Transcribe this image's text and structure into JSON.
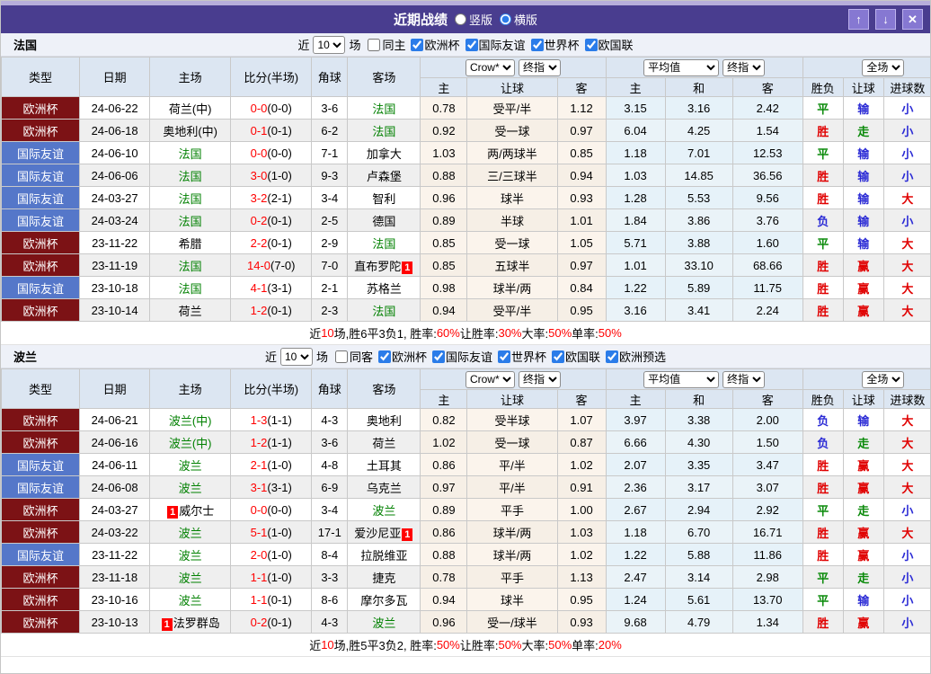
{
  "titlebar": {
    "title": "近期战绩",
    "radio_vertical": "竖版",
    "radio_horizontal": "横版",
    "icons": {
      "up": "↑",
      "down": "↓",
      "close": "✕"
    }
  },
  "headers": {
    "type": "类型",
    "date": "日期",
    "home": "主场",
    "score": "比分(半场)",
    "corner": "角球",
    "away": "客场",
    "home_odds": "主",
    "handicap": "让球",
    "away_odds": "客",
    "avg_home": "主",
    "avg_draw": "和",
    "avg_away": "客",
    "result": "胜负",
    "handicap_result": "让球",
    "goals": "进球数"
  },
  "controls": {
    "crow": "Crow*",
    "final": "终指",
    "average": "平均值",
    "full": "全场"
  },
  "sections": [
    {
      "team": "法国",
      "filter": {
        "near_label": "近",
        "count": "10",
        "unit_label": "场",
        "same_label": "同主",
        "competitions": [
          "欧洲杯",
          "国际友谊",
          "世界杯",
          "欧国联"
        ]
      },
      "rows": [
        {
          "league": "欧洲杯",
          "date": "24-06-22",
          "home": "荷兰(中)",
          "home_focus": false,
          "score": "0-0",
          "half": "(0-0)",
          "corner": "3-6",
          "away": "法国",
          "away_focus": true,
          "odds": [
            "0.78",
            "受平/半",
            "1.12"
          ],
          "avg": [
            "3.15",
            "3.16",
            "2.42"
          ],
          "res": [
            "平",
            "输",
            "小"
          ]
        },
        {
          "league": "欧洲杯",
          "date": "24-06-18",
          "home": "奥地利(中)",
          "home_focus": false,
          "score": "0-1",
          "half": "(0-1)",
          "corner": "6-2",
          "away": "法国",
          "away_focus": true,
          "odds": [
            "0.92",
            "受一球",
            "0.97"
          ],
          "avg": [
            "6.04",
            "4.25",
            "1.54"
          ],
          "res": [
            "胜",
            "走",
            "小"
          ]
        },
        {
          "league": "国际友谊",
          "date": "24-06-10",
          "home": "法国",
          "home_focus": true,
          "score": "0-0",
          "half": "(0-0)",
          "corner": "7-1",
          "away": "加拿大",
          "away_focus": false,
          "odds": [
            "1.03",
            "两/两球半",
            "0.85"
          ],
          "avg": [
            "1.18",
            "7.01",
            "12.53"
          ],
          "res": [
            "平",
            "输",
            "小"
          ]
        },
        {
          "league": "国际友谊",
          "date": "24-06-06",
          "home": "法国",
          "home_focus": true,
          "score": "3-0",
          "half": "(1-0)",
          "corner": "9-3",
          "away": "卢森堡",
          "away_focus": false,
          "odds": [
            "0.88",
            "三/三球半",
            "0.94"
          ],
          "avg": [
            "1.03",
            "14.85",
            "36.56"
          ],
          "res": [
            "胜",
            "输",
            "小"
          ]
        },
        {
          "league": "国际友谊",
          "date": "24-03-27",
          "home": "法国",
          "home_focus": true,
          "score": "3-2",
          "half": "(2-1)",
          "corner": "3-4",
          "away": "智利",
          "away_focus": false,
          "odds": [
            "0.96",
            "球半",
            "0.93"
          ],
          "avg": [
            "1.28",
            "5.53",
            "9.56"
          ],
          "res": [
            "胜",
            "输",
            "大"
          ]
        },
        {
          "league": "国际友谊",
          "date": "24-03-24",
          "home": "法国",
          "home_focus": true,
          "score": "0-2",
          "half": "(0-1)",
          "corner": "2-5",
          "away": "德国",
          "away_focus": false,
          "odds": [
            "0.89",
            "半球",
            "1.01"
          ],
          "avg": [
            "1.84",
            "3.86",
            "3.76"
          ],
          "res": [
            "负",
            "输",
            "小"
          ]
        },
        {
          "league": "欧洲杯",
          "date": "23-11-22",
          "home": "希腊",
          "home_focus": false,
          "score": "2-2",
          "half": "(0-1)",
          "corner": "2-9",
          "away": "法国",
          "away_focus": true,
          "odds": [
            "0.85",
            "受一球",
            "1.05"
          ],
          "avg": [
            "5.71",
            "3.88",
            "1.60"
          ],
          "res": [
            "平",
            "输",
            "大"
          ]
        },
        {
          "league": "欧洲杯",
          "date": "23-11-19",
          "home": "法国",
          "home_focus": true,
          "score": "14-0",
          "half": "(7-0)",
          "corner": "7-0",
          "away": "直布罗陀",
          "away_focus": false,
          "away_badge": "1",
          "odds": [
            "0.85",
            "五球半",
            "0.97"
          ],
          "avg": [
            "1.01",
            "33.10",
            "68.66"
          ],
          "res": [
            "胜",
            "赢",
            "大"
          ]
        },
        {
          "league": "国际友谊",
          "date": "23-10-18",
          "home": "法国",
          "home_focus": true,
          "score": "4-1",
          "half": "(3-1)",
          "corner": "2-1",
          "away": "苏格兰",
          "away_focus": false,
          "odds": [
            "0.98",
            "球半/两",
            "0.84"
          ],
          "avg": [
            "1.22",
            "5.89",
            "11.75"
          ],
          "res": [
            "胜",
            "赢",
            "大"
          ]
        },
        {
          "league": "欧洲杯",
          "date": "23-10-14",
          "home": "荷兰",
          "home_focus": false,
          "score": "1-2",
          "half": "(0-1)",
          "corner": "2-3",
          "away": "法国",
          "away_focus": true,
          "odds": [
            "0.94",
            "受平/半",
            "0.95"
          ],
          "avg": [
            "3.16",
            "3.41",
            "2.24"
          ],
          "res": [
            "胜",
            "赢",
            "大"
          ]
        }
      ],
      "summary": [
        {
          "t": "近"
        },
        {
          "t": "10",
          "red": true
        },
        {
          "t": "场,胜6平3负1, 胜率:"
        },
        {
          "t": "60%",
          "red": true
        },
        {
          "t": " 让胜率:"
        },
        {
          "t": "30%",
          "red": true
        },
        {
          "t": " 大率:"
        },
        {
          "t": "50%",
          "red": true
        },
        {
          "t": " 单率:"
        },
        {
          "t": "50%",
          "red": true
        }
      ]
    },
    {
      "team": "波兰",
      "filter": {
        "near_label": "近",
        "count": "10",
        "unit_label": "场",
        "same_label": "同客",
        "competitions": [
          "欧洲杯",
          "国际友谊",
          "世界杯",
          "欧国联",
          "欧洲预选"
        ]
      },
      "rows": [
        {
          "league": "欧洲杯",
          "date": "24-06-21",
          "home": "波兰(中)",
          "home_focus": true,
          "score": "1-3",
          "half": "(1-1)",
          "corner": "4-3",
          "away": "奥地利",
          "away_focus": false,
          "odds": [
            "0.82",
            "受半球",
            "1.07"
          ],
          "avg": [
            "3.97",
            "3.38",
            "2.00"
          ],
          "res": [
            "负",
            "输",
            "大"
          ]
        },
        {
          "league": "欧洲杯",
          "date": "24-06-16",
          "home": "波兰(中)",
          "home_focus": true,
          "score": "1-2",
          "half": "(1-1)",
          "corner": "3-6",
          "away": "荷兰",
          "away_focus": false,
          "odds": [
            "1.02",
            "受一球",
            "0.87"
          ],
          "avg": [
            "6.66",
            "4.30",
            "1.50"
          ],
          "res": [
            "负",
            "走",
            "大"
          ]
        },
        {
          "league": "国际友谊",
          "date": "24-06-11",
          "home": "波兰",
          "home_focus": true,
          "score": "2-1",
          "half": "(1-0)",
          "corner": "4-8",
          "away": "土耳其",
          "away_focus": false,
          "odds": [
            "0.86",
            "平/半",
            "1.02"
          ],
          "avg": [
            "2.07",
            "3.35",
            "3.47"
          ],
          "res": [
            "胜",
            "赢",
            "大"
          ]
        },
        {
          "league": "国际友谊",
          "date": "24-06-08",
          "home": "波兰",
          "home_focus": true,
          "score": "3-1",
          "half": "(3-1)",
          "corner": "6-9",
          "away": "乌克兰",
          "away_focus": false,
          "odds": [
            "0.97",
            "平/半",
            "0.91"
          ],
          "avg": [
            "2.36",
            "3.17",
            "3.07"
          ],
          "res": [
            "胜",
            "赢",
            "大"
          ]
        },
        {
          "league": "欧洲杯",
          "date": "24-03-27",
          "home": "威尔士",
          "home_focus": false,
          "home_badge": "1",
          "score": "0-0",
          "half": "(0-0)",
          "corner": "3-4",
          "away": "波兰",
          "away_focus": true,
          "odds": [
            "0.89",
            "平手",
            "1.00"
          ],
          "avg": [
            "2.67",
            "2.94",
            "2.92"
          ],
          "res": [
            "平",
            "走",
            "小"
          ]
        },
        {
          "league": "欧洲杯",
          "date": "24-03-22",
          "home": "波兰",
          "home_focus": true,
          "score": "5-1",
          "half": "(1-0)",
          "corner": "17-1",
          "away": "爱沙尼亚",
          "away_focus": false,
          "away_badge": "1",
          "odds": [
            "0.86",
            "球半/两",
            "1.03"
          ],
          "avg": [
            "1.18",
            "6.70",
            "16.71"
          ],
          "res": [
            "胜",
            "赢",
            "大"
          ]
        },
        {
          "league": "国际友谊",
          "date": "23-11-22",
          "home": "波兰",
          "home_focus": true,
          "score": "2-0",
          "half": "(1-0)",
          "corner": "8-4",
          "away": "拉脱维亚",
          "away_focus": false,
          "odds": [
            "0.88",
            "球半/两",
            "1.02"
          ],
          "avg": [
            "1.22",
            "5.88",
            "11.86"
          ],
          "res": [
            "胜",
            "赢",
            "小"
          ]
        },
        {
          "league": "欧洲杯",
          "date": "23-11-18",
          "home": "波兰",
          "home_focus": true,
          "score": "1-1",
          "half": "(1-0)",
          "corner": "3-3",
          "away": "捷克",
          "away_focus": false,
          "odds": [
            "0.78",
            "平手",
            "1.13"
          ],
          "avg": [
            "2.47",
            "3.14",
            "2.98"
          ],
          "res": [
            "平",
            "走",
            "小"
          ]
        },
        {
          "league": "欧洲杯",
          "date": "23-10-16",
          "home": "波兰",
          "home_focus": true,
          "score": "1-1",
          "half": "(0-1)",
          "corner": "8-6",
          "away": "摩尔多瓦",
          "away_focus": false,
          "odds": [
            "0.94",
            "球半",
            "0.95"
          ],
          "avg": [
            "1.24",
            "5.61",
            "13.70"
          ],
          "res": [
            "平",
            "输",
            "小"
          ]
        },
        {
          "league": "欧洲杯",
          "date": "23-10-13",
          "home": "法罗群岛",
          "home_focus": false,
          "home_badge": "1",
          "score": "0-2",
          "half": "(0-1)",
          "corner": "4-3",
          "away": "波兰",
          "away_focus": true,
          "odds": [
            "0.96",
            "受一/球半",
            "0.93"
          ],
          "avg": [
            "9.68",
            "4.79",
            "1.34"
          ],
          "res": [
            "胜",
            "赢",
            "小"
          ]
        }
      ],
      "summary": [
        {
          "t": "近"
        },
        {
          "t": "10",
          "red": true
        },
        {
          "t": "场,胜5平3负2, 胜率:"
        },
        {
          "t": "50%",
          "red": true
        },
        {
          "t": " 让胜率:"
        },
        {
          "t": "50%",
          "red": true
        },
        {
          "t": " 大率:"
        },
        {
          "t": "50%",
          "red": true
        },
        {
          "t": " 单率:"
        },
        {
          "t": "20%",
          "red": true
        }
      ]
    }
  ]
}
